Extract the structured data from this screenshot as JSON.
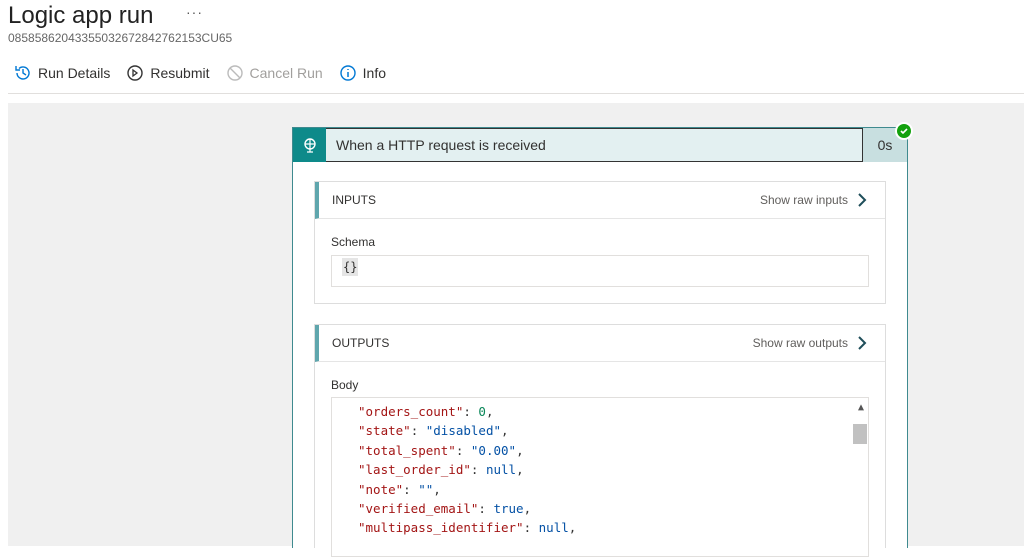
{
  "header": {
    "title": "Logic app run",
    "more": "···",
    "run_id": "08585862043355032672842762153CU65"
  },
  "toolbar": [
    {
      "label": "Run Details",
      "icon": "history-icon"
    },
    {
      "label": "Resubmit",
      "icon": "resubmit-icon"
    },
    {
      "label": "Cancel Run",
      "icon": "cancel-icon",
      "disabled": true
    },
    {
      "label": "Info",
      "icon": "info-icon"
    }
  ],
  "card": {
    "title": "When a HTTP request is received",
    "duration": "0s",
    "status": "succeeded",
    "inputs": {
      "header": "INPUTS",
      "raw_link": "Show raw inputs",
      "field_label": "Schema",
      "field_value": "{}"
    },
    "outputs": {
      "header": "OUTPUTS",
      "raw_link": "Show raw outputs",
      "field_label": "Body",
      "lines": [
        {
          "key": "\"orders_count\"",
          "value": "0",
          "type": "n"
        },
        {
          "key": "\"state\"",
          "value": "\"disabled\"",
          "type": "s"
        },
        {
          "key": "\"total_spent\"",
          "value": "\"0.00\"",
          "type": "s"
        },
        {
          "key": "\"last_order_id\"",
          "value": "null",
          "type": "s"
        },
        {
          "key": "\"note\"",
          "value": "\"\"",
          "type": "s"
        },
        {
          "key": "\"verified_email\"",
          "value": "true",
          "type": "s"
        },
        {
          "key": "\"multipass_identifier\"",
          "value": "null",
          "type": "s"
        }
      ]
    }
  }
}
